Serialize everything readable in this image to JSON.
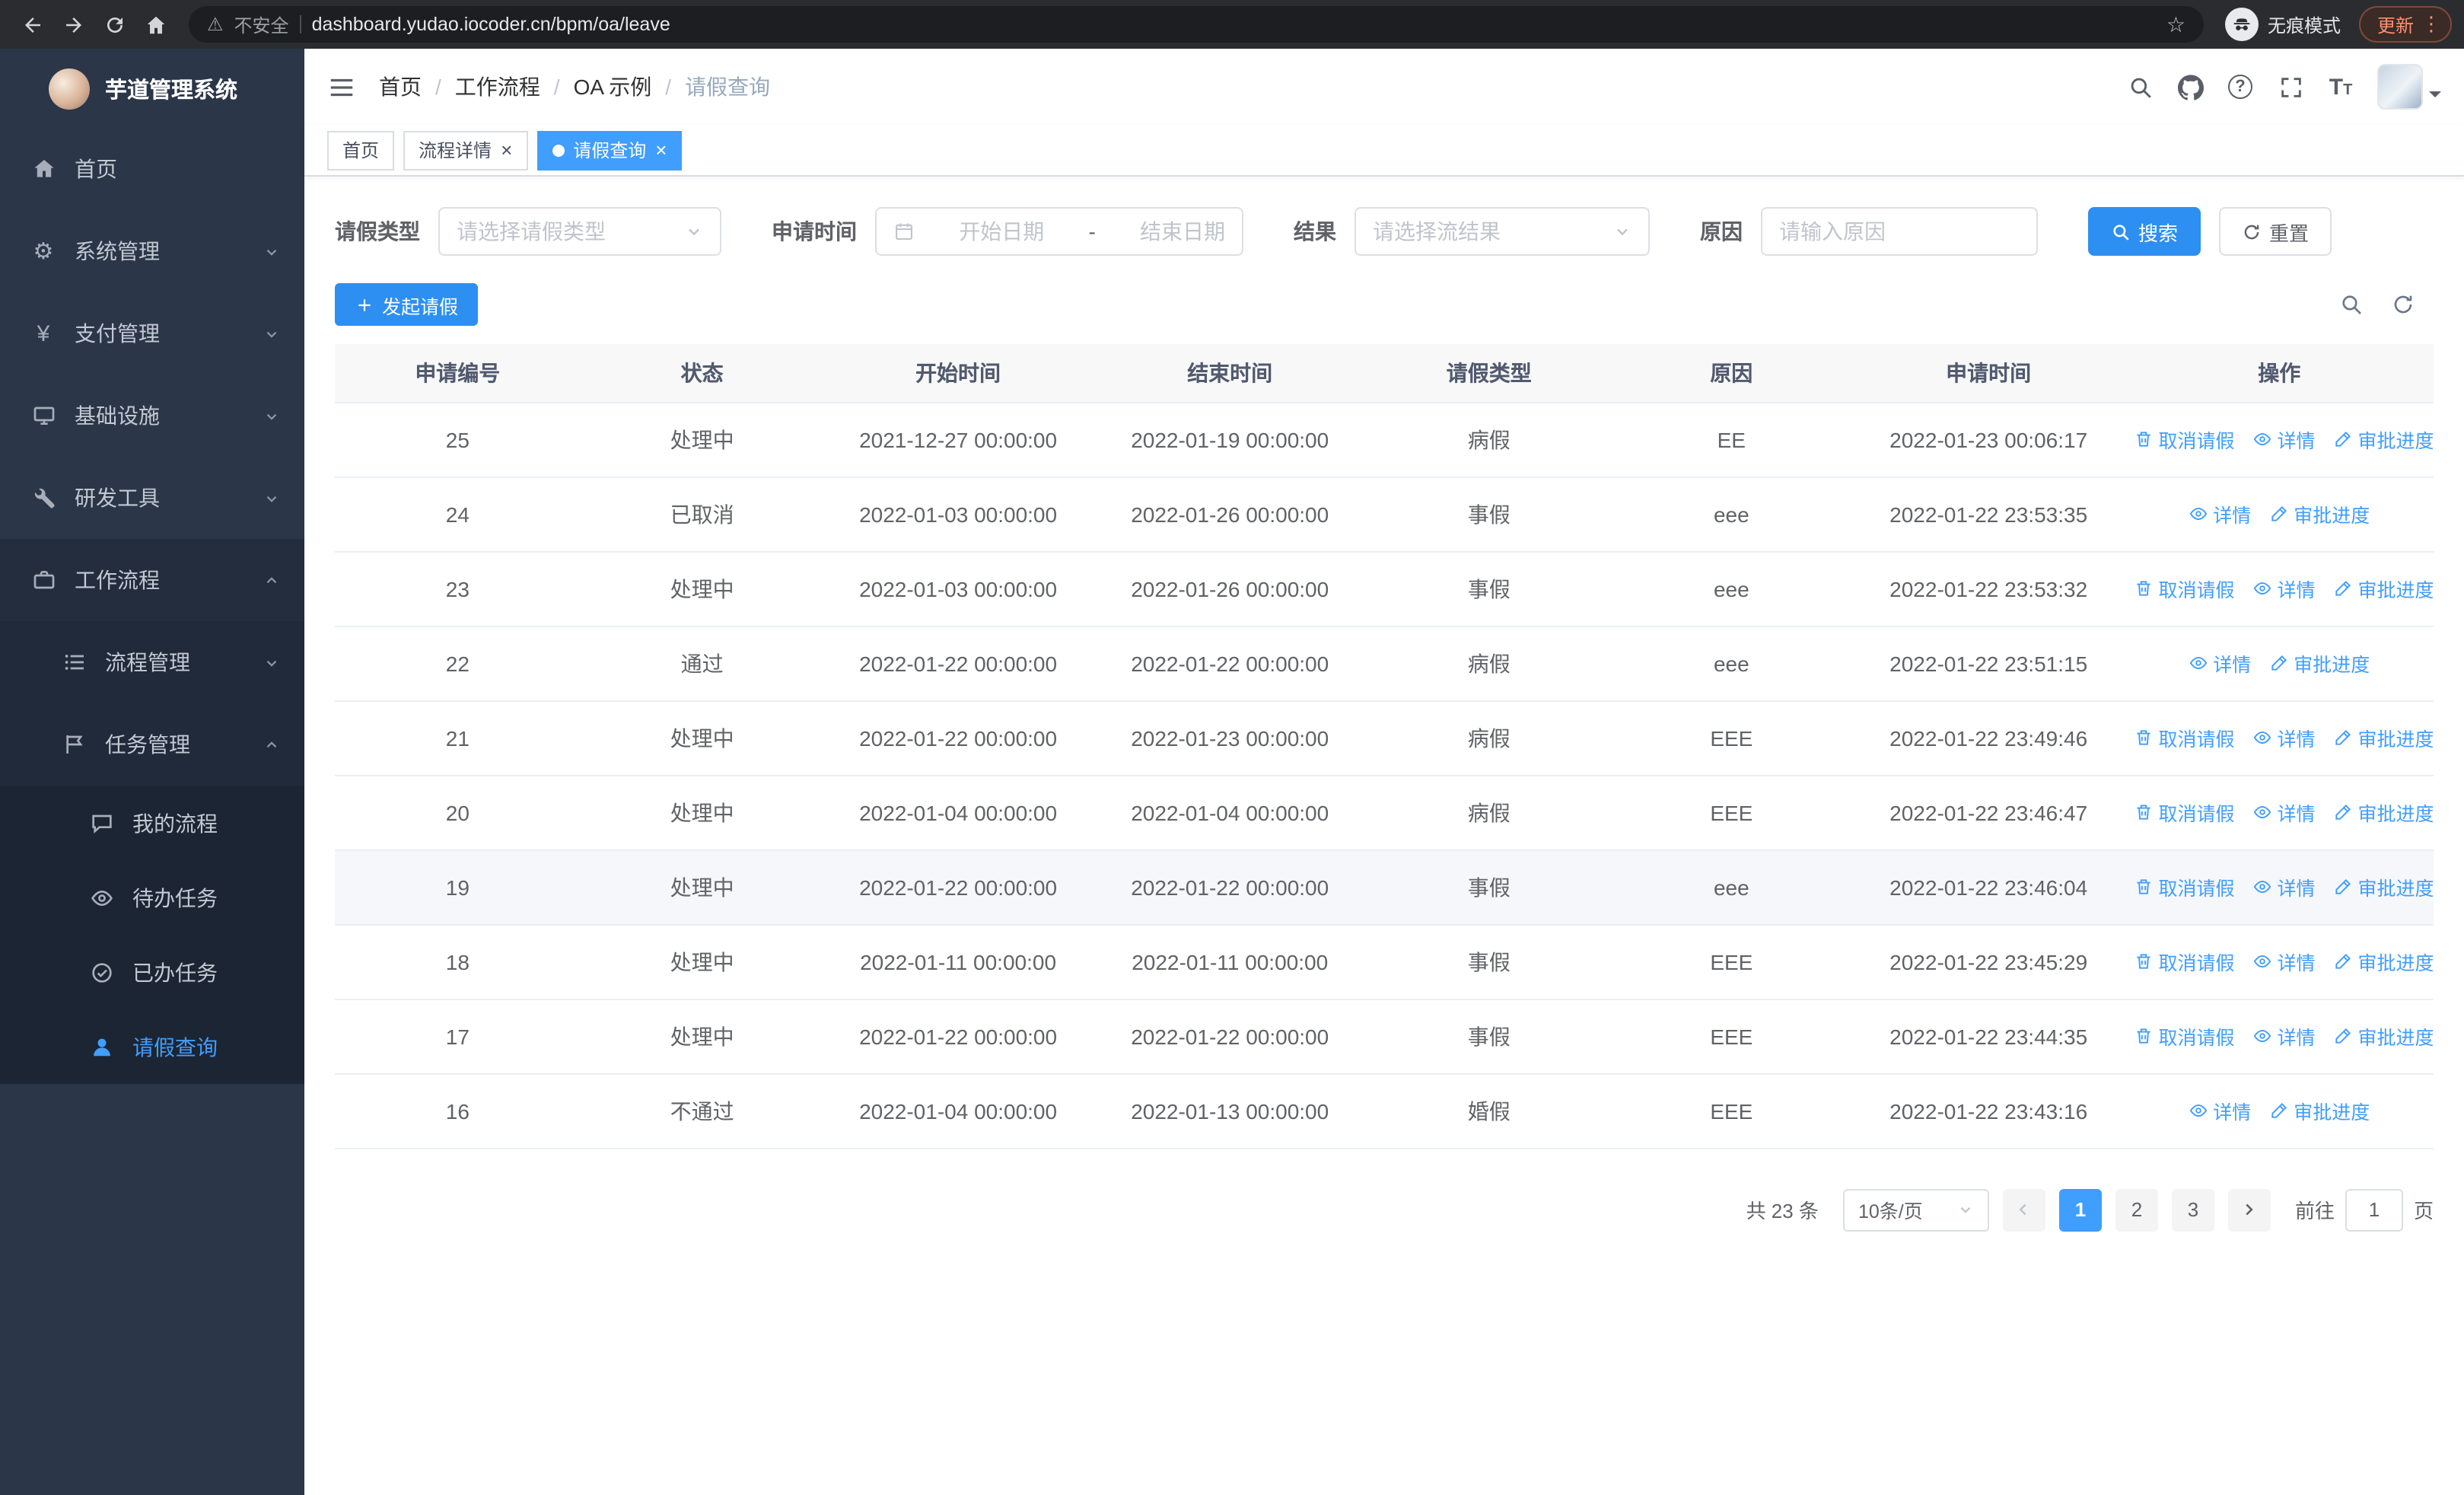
{
  "colors": {
    "primary": "#2d8ff2",
    "accent": "#409eff",
    "sidebar_bg": "#2b3648",
    "active_text": "#409eff"
  },
  "browser": {
    "security_label": "不安全",
    "url": "dashboard.yudao.iocoder.cn/bpm/oa/leave",
    "incognito_label": "无痕模式",
    "update_label": "更新"
  },
  "sidebar": {
    "logo_title": "芋道管理系统",
    "items": [
      {
        "label": "首页",
        "icon": "home-icon"
      },
      {
        "label": "系统管理",
        "icon": "gear-icon"
      },
      {
        "label": "支付管理",
        "icon": "yen-icon"
      },
      {
        "label": "基础设施",
        "icon": "monitor-icon"
      },
      {
        "label": "研发工具",
        "icon": "wrench-icon"
      },
      {
        "label": "工作流程",
        "icon": "briefcase-icon"
      }
    ],
    "workflow_children": [
      {
        "label": "流程管理",
        "icon": "list-icon"
      },
      {
        "label": "任务管理",
        "icon": "flag-icon"
      }
    ],
    "task_children": [
      {
        "label": "我的流程",
        "icon": "chat-icon"
      },
      {
        "label": "待办任务",
        "icon": "eye-icon"
      },
      {
        "label": "已办任务",
        "icon": "done-icon"
      },
      {
        "label": "请假查询",
        "icon": "user-icon",
        "active": true
      }
    ]
  },
  "header": {
    "breadcrumb": [
      "首页",
      "工作流程",
      "OA 示例",
      "请假查询"
    ],
    "separator": "/"
  },
  "tabs": [
    {
      "label": "首页",
      "closable": false,
      "active": false
    },
    {
      "label": "流程详情",
      "closable": true,
      "active": false
    },
    {
      "label": "请假查询",
      "closable": true,
      "active": true
    }
  ],
  "filters": {
    "leave_type": {
      "label": "请假类型",
      "placeholder": "请选择请假类型"
    },
    "apply_time": {
      "label": "申请时间",
      "start_placeholder": "开始日期",
      "separator": "-",
      "end_placeholder": "结束日期"
    },
    "result": {
      "label": "结果",
      "placeholder": "请选择流结果"
    },
    "reason": {
      "label": "原因",
      "placeholder": "请输入原因"
    },
    "search_label": "搜索",
    "reset_label": "重置"
  },
  "toolbar": {
    "create_label": "发起请假"
  },
  "table": {
    "columns": [
      "申请编号",
      "状态",
      "开始时间",
      "结束时间",
      "请假类型",
      "原因",
      "申请时间",
      "操作"
    ],
    "column_keys": [
      "id",
      "status",
      "start",
      "end",
      "type",
      "reason",
      "apply_time"
    ],
    "action_labels": {
      "cancel": "取消请假",
      "detail": "详情",
      "progress": "审批进度"
    },
    "rows": [
      {
        "id": "25",
        "status": "处理中",
        "start": "2021-12-27 00:00:00",
        "end": "2022-01-19 00:00:00",
        "type": "病假",
        "reason": "EE",
        "apply_time": "2022-01-23 00:06:17",
        "can_cancel": true,
        "highlighted": false
      },
      {
        "id": "24",
        "status": "已取消",
        "start": "2022-01-03 00:00:00",
        "end": "2022-01-26 00:00:00",
        "type": "事假",
        "reason": "eee",
        "apply_time": "2022-01-22 23:53:35",
        "can_cancel": false,
        "highlighted": false
      },
      {
        "id": "23",
        "status": "处理中",
        "start": "2022-01-03 00:00:00",
        "end": "2022-01-26 00:00:00",
        "type": "事假",
        "reason": "eee",
        "apply_time": "2022-01-22 23:53:32",
        "can_cancel": true,
        "highlighted": false
      },
      {
        "id": "22",
        "status": "通过",
        "start": "2022-01-22 00:00:00",
        "end": "2022-01-22 00:00:00",
        "type": "病假",
        "reason": "eee",
        "apply_time": "2022-01-22 23:51:15",
        "can_cancel": false,
        "highlighted": false
      },
      {
        "id": "21",
        "status": "处理中",
        "start": "2022-01-22 00:00:00",
        "end": "2022-01-23 00:00:00",
        "type": "病假",
        "reason": "EEE",
        "apply_time": "2022-01-22 23:49:46",
        "can_cancel": true,
        "highlighted": false
      },
      {
        "id": "20",
        "status": "处理中",
        "start": "2022-01-04 00:00:00",
        "end": "2022-01-04 00:00:00",
        "type": "病假",
        "reason": "EEE",
        "apply_time": "2022-01-22 23:46:47",
        "can_cancel": true,
        "highlighted": false
      },
      {
        "id": "19",
        "status": "处理中",
        "start": "2022-01-22 00:00:00",
        "end": "2022-01-22 00:00:00",
        "type": "事假",
        "reason": "eee",
        "apply_time": "2022-01-22 23:46:04",
        "can_cancel": true,
        "highlighted": true
      },
      {
        "id": "18",
        "status": "处理中",
        "start": "2022-01-11 00:00:00",
        "end": "2022-01-11 00:00:00",
        "type": "事假",
        "reason": "EEE",
        "apply_time": "2022-01-22 23:45:29",
        "can_cancel": true,
        "highlighted": false
      },
      {
        "id": "17",
        "status": "处理中",
        "start": "2022-01-22 00:00:00",
        "end": "2022-01-22 00:00:00",
        "type": "事假",
        "reason": "EEE",
        "apply_time": "2022-01-22 23:44:35",
        "can_cancel": true,
        "highlighted": false
      },
      {
        "id": "16",
        "status": "不通过",
        "start": "2022-01-04 00:00:00",
        "end": "2022-01-13 00:00:00",
        "type": "婚假",
        "reason": "EEE",
        "apply_time": "2022-01-22 23:43:16",
        "can_cancel": false,
        "highlighted": false
      }
    ]
  },
  "pagination": {
    "total_label": "共 23 条",
    "page_size_label": "10条/页",
    "pages": [
      "1",
      "2",
      "3"
    ],
    "active_page": "1",
    "goto_prefix": "前往",
    "goto_value": "1",
    "goto_suffix": "页"
  }
}
